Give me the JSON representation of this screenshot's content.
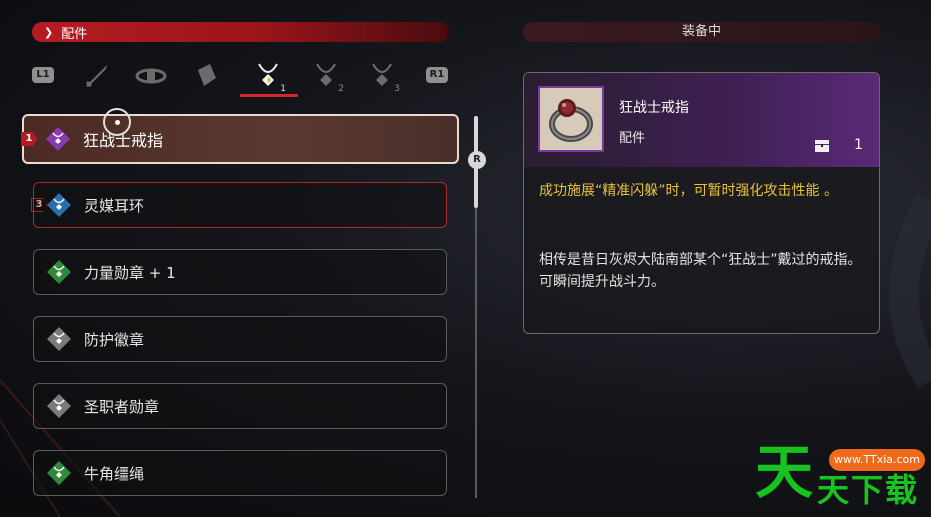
{
  "header": {
    "category_chevron": "❯",
    "category_label": "配件",
    "equipped_label": "装备中"
  },
  "tabs": {
    "left_button": "L1",
    "right_button": "R1",
    "items": [
      {
        "icon": "sword-icon",
        "num": ""
      },
      {
        "icon": "belt-icon",
        "num": ""
      },
      {
        "icon": "gauntlet-icon",
        "num": ""
      },
      {
        "icon": "necklace-icon",
        "num": "1",
        "active": true
      },
      {
        "icon": "necklace-icon",
        "num": "2"
      },
      {
        "icon": "necklace-icon",
        "num": "3"
      }
    ]
  },
  "list": {
    "scroll_button": "R",
    "items": [
      {
        "label": "狂战士戒指",
        "slot": "1",
        "gem_color": "#8a3ab0",
        "selected": true
      },
      {
        "label": "灵媒耳环",
        "slot": "3",
        "gem_color": "#2a6fb0"
      },
      {
        "label": "力量勋章 + 1",
        "gem_color": "#2f8a3a"
      },
      {
        "label": "防护徽章",
        "gem_color": "#7a7a7a"
      },
      {
        "label": "圣职者勋章",
        "gem_color": "#7a7a7a"
      },
      {
        "label": "牛角缰绳",
        "gem_color": "#2f8a3a"
      }
    ]
  },
  "detail": {
    "name": "狂战士戒指",
    "category": "配件",
    "count": "1",
    "effect": "成功施展“精准闪躲”时，可暂时强化攻击性能 。",
    "lore": "相传是昔日灰烬大陆南部某个“狂战士”戴过的戒指。\n可瞬间提升战斗力。"
  },
  "watermark": {
    "url": "www.TTxia.com",
    "big": "天",
    "small": "天下载"
  }
}
